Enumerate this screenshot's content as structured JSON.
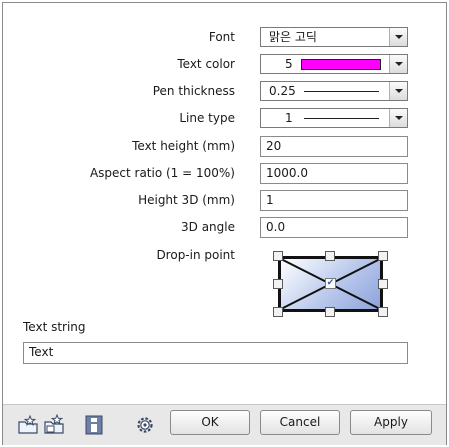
{
  "properties": {
    "font": {
      "label": "Font",
      "value": "맑은 고딕"
    },
    "text_color": {
      "label": "Text color",
      "value": "5",
      "swatch_color": "#ff00ff"
    },
    "pen_thickness": {
      "label": "Pen thickness",
      "value": "0.25"
    },
    "line_type": {
      "label": "Line type",
      "value": "1"
    },
    "text_height": {
      "label": "Text height (mm)",
      "value": "20"
    },
    "aspect_ratio": {
      "label": "Aspect ratio (1 = 100%)",
      "value": "1000.0"
    },
    "height_3d": {
      "label": "Height 3D (mm)",
      "value": "1"
    },
    "angle_3d": {
      "label": "3D angle",
      "value": "0.0"
    },
    "drop_in_point": {
      "label": "Drop-in point",
      "selected": "center"
    }
  },
  "text_string": {
    "label": "Text string",
    "value": "Text"
  },
  "footer": {
    "icons": [
      "open-favorite-icon",
      "save-favorite-icon",
      "properties-icon",
      "settings-gear-icon"
    ],
    "ok_label": "OK",
    "cancel_label": "Cancel",
    "apply_label": "Apply"
  },
  "colors": {
    "accent_magenta": "#ff00ff",
    "drop_fill": "#a8b8e6"
  }
}
